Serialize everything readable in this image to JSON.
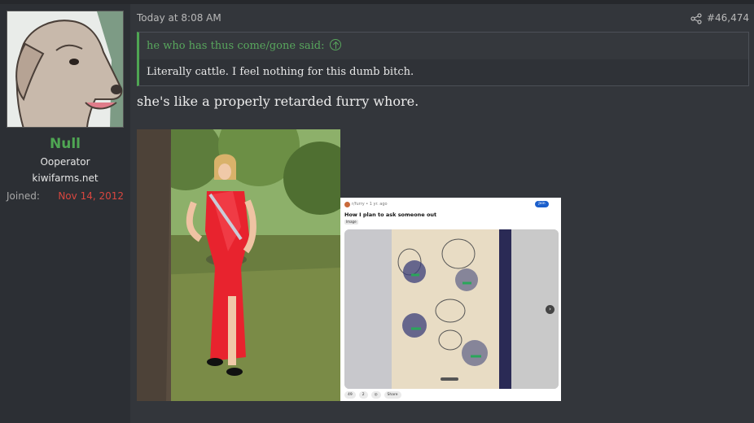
{
  "user": {
    "name": "Null",
    "title": "Ooperator",
    "site": "kiwifarms.net",
    "joined_label": "Joined:",
    "joined_value": "Nov 14, 2012"
  },
  "message": {
    "time": "Today at 8:08 AM",
    "post_number": "#46,474",
    "quote_author": "he who has thus come/gone said:",
    "quote_text": "Literally cattle. I feel nothing for this dumb bitch.",
    "text": "she's like a properly retarded furry whore."
  },
  "attachment_screenshot": {
    "community": "r/furry • 1 yr. ago",
    "join_label": "Join",
    "title": "How I plan to ask someone out",
    "tag": "Image",
    "upvotes": "49",
    "comments": "2",
    "share_label": "Share"
  },
  "colors": {
    "page_bg": "#33363b",
    "sidebar_bg": "#2c2f34",
    "username": "#4fa653",
    "joined_value": "#d9463f",
    "quote_accent": "#4fa653"
  },
  "icons": {
    "share": "share-icon",
    "quote_jump": "arrow-up-circle-icon"
  }
}
